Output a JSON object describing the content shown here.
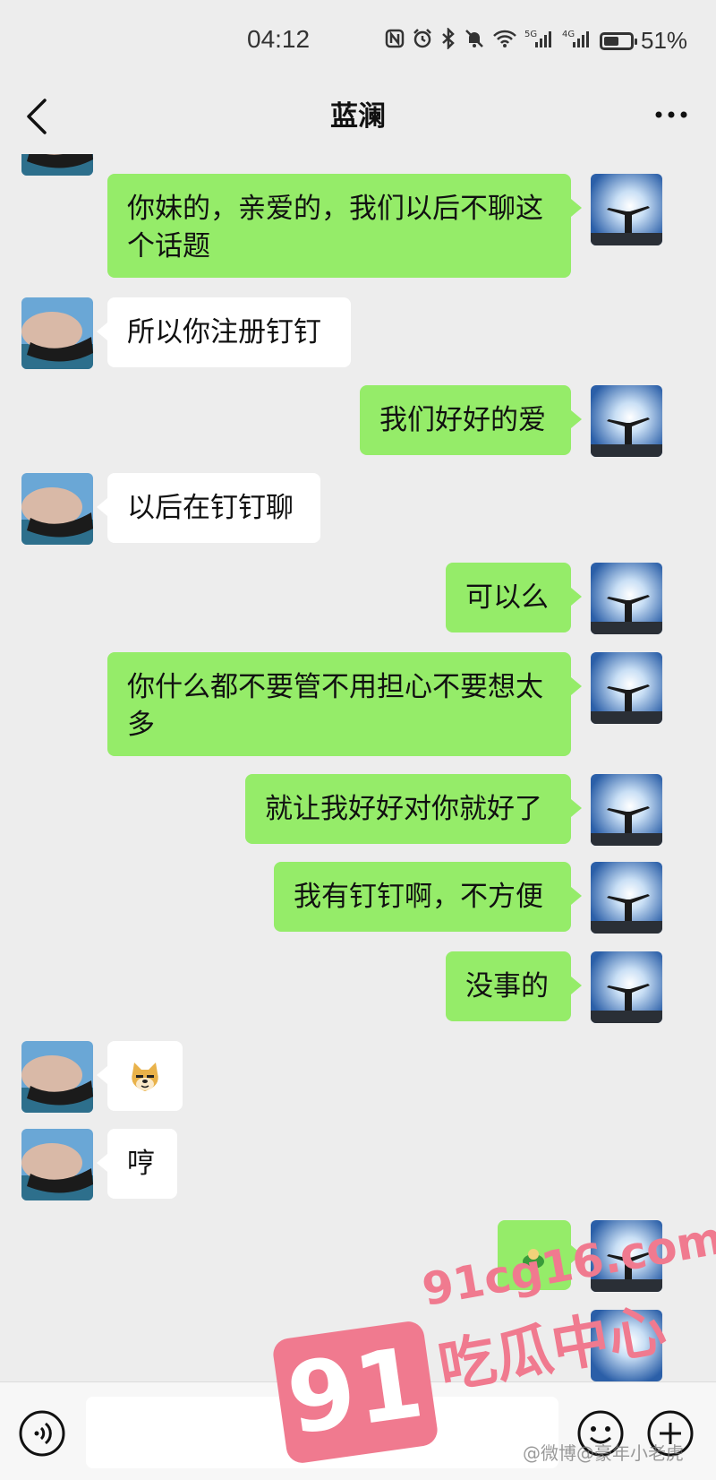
{
  "status_bar": {
    "time": "04:12",
    "icons": [
      "nfc-icon",
      "alarm-icon",
      "bluetooth-icon",
      "mute-icon",
      "wifi-icon",
      "signal-5g-icon",
      "signal-4g-icon",
      "battery-icon"
    ],
    "battery_text": "51%"
  },
  "header": {
    "title": "蓝澜"
  },
  "messages": [
    {
      "side": "in",
      "text": "",
      "avatar": "contact-avatar"
    },
    {
      "side": "out",
      "text": "你妹的，亲爱的，我们以后不聊这个话题",
      "avatar": "self-avatar"
    },
    {
      "side": "in",
      "text": "所以你注册钉钉",
      "avatar": "contact-avatar"
    },
    {
      "side": "out",
      "text": "我们好好的爱",
      "avatar": "self-avatar"
    },
    {
      "side": "in",
      "text": "以后在钉钉聊",
      "avatar": "contact-avatar"
    },
    {
      "side": "out",
      "text": "可以么",
      "avatar": "self-avatar"
    },
    {
      "side": "out",
      "text": "你什么都不要管不用担心不要想太多",
      "avatar": "self-avatar"
    },
    {
      "side": "out",
      "text": "就让我好好对你就好了",
      "avatar": "self-avatar"
    },
    {
      "side": "out",
      "text": "我有钉钉啊，不方便",
      "avatar": "self-avatar"
    },
    {
      "side": "out",
      "text": "没事的",
      "avatar": "self-avatar"
    },
    {
      "side": "in",
      "text": "",
      "sticker": "doge-emoji-icon",
      "avatar": "contact-avatar"
    },
    {
      "side": "in",
      "text": "哼",
      "avatar": "contact-avatar"
    },
    {
      "side": "out",
      "text": "",
      "sticker": "sticker-icon",
      "avatar": "self-avatar"
    }
  ],
  "input_bar": {
    "placeholder": "",
    "value": ""
  },
  "watermark": {
    "logo_number": "91",
    "site": "91cg16.com",
    "chinese": "吃瓜中心",
    "weibo_credit": "@微博@豪年小老虎"
  },
  "colors": {
    "outgoing_bubble": "#95ec69",
    "incoming_bubble": "#ffffff",
    "background": "#ededed",
    "watermark": "#f07a8f"
  }
}
